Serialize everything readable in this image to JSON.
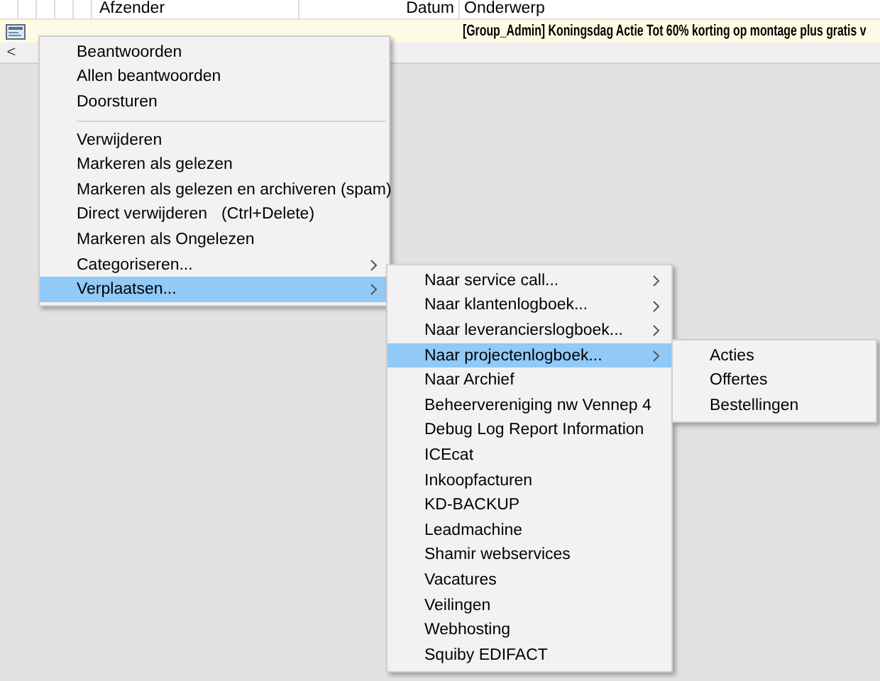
{
  "message_list": {
    "columns": [
      {
        "label": "Afzender"
      },
      {
        "label": "Datum"
      },
      {
        "label": "Onderwerp"
      }
    ],
    "rows": [
      {
        "subject": "[Group_Admin] Koningsdag Actie Tot 60% korting op montage plus gratis v"
      }
    ],
    "scroll_left": "<"
  },
  "context_menu": {
    "items": [
      {
        "kind": "item",
        "label": "Beantwoorden",
        "has_submenu": false,
        "selected": false
      },
      {
        "kind": "item",
        "label": "Allen beantwoorden",
        "has_submenu": false,
        "selected": false
      },
      {
        "kind": "item",
        "label": "Doorsturen",
        "has_submenu": false,
        "selected": false
      },
      {
        "kind": "separator"
      },
      {
        "kind": "item",
        "label": "Verwijderen",
        "has_submenu": false,
        "selected": false
      },
      {
        "kind": "item",
        "label": "Markeren als gelezen",
        "has_submenu": false,
        "selected": false
      },
      {
        "kind": "item",
        "label": "Markeren als gelezen en archiveren (spam)",
        "has_submenu": false,
        "selected": false
      },
      {
        "kind": "item",
        "label": "Direct verwijderen",
        "shortcut": "(Ctrl+Delete)",
        "has_submenu": false,
        "selected": false
      },
      {
        "kind": "item",
        "label": "Markeren als Ongelezen",
        "has_submenu": false,
        "selected": false
      },
      {
        "kind": "item",
        "label": "Categoriseren...",
        "has_submenu": true,
        "selected": false
      },
      {
        "kind": "item",
        "label": "Verplaatsen...",
        "has_submenu": true,
        "selected": true
      }
    ]
  },
  "move_submenu": {
    "items": [
      {
        "kind": "item",
        "label": "Naar service call...",
        "has_submenu": true,
        "selected": false
      },
      {
        "kind": "item",
        "label": "Naar klantenlogboek...",
        "has_submenu": true,
        "selected": false
      },
      {
        "kind": "item",
        "label": "Naar leverancierslogboek...",
        "has_submenu": true,
        "selected": false
      },
      {
        "kind": "item",
        "label": "Naar projectenlogboek...",
        "has_submenu": true,
        "selected": true
      },
      {
        "kind": "item",
        "label": "Naar Archief",
        "has_submenu": false,
        "selected": false
      },
      {
        "kind": "item",
        "label": "Beheervereniging nw Vennep 4",
        "has_submenu": false,
        "selected": false
      },
      {
        "kind": "item",
        "label": "Debug Log Report Information",
        "has_submenu": false,
        "selected": false
      },
      {
        "kind": "item",
        "label": "ICEcat",
        "has_submenu": false,
        "selected": false
      },
      {
        "kind": "item",
        "label": "Inkoopfacturen",
        "has_submenu": false,
        "selected": false
      },
      {
        "kind": "item",
        "label": "KD-BACKUP",
        "has_submenu": false,
        "selected": false
      },
      {
        "kind": "item",
        "label": "Leadmachine",
        "has_submenu": false,
        "selected": false
      },
      {
        "kind": "item",
        "label": "Shamir webservices",
        "has_submenu": false,
        "selected": false
      },
      {
        "kind": "item",
        "label": "Vacatures",
        "has_submenu": false,
        "selected": false
      },
      {
        "kind": "item",
        "label": "Veilingen",
        "has_submenu": false,
        "selected": false
      },
      {
        "kind": "item",
        "label": "Webhosting",
        "has_submenu": false,
        "selected": false
      },
      {
        "kind": "item",
        "label": "Squiby EDIFACT",
        "has_submenu": false,
        "selected": false
      }
    ]
  },
  "project_submenu": {
    "items": [
      {
        "kind": "item",
        "label": "Acties",
        "has_submenu": false,
        "selected": false
      },
      {
        "kind": "item",
        "label": "Offertes",
        "has_submenu": false,
        "selected": false
      },
      {
        "kind": "item",
        "label": "Bestellingen",
        "has_submenu": false,
        "selected": false
      }
    ]
  }
}
